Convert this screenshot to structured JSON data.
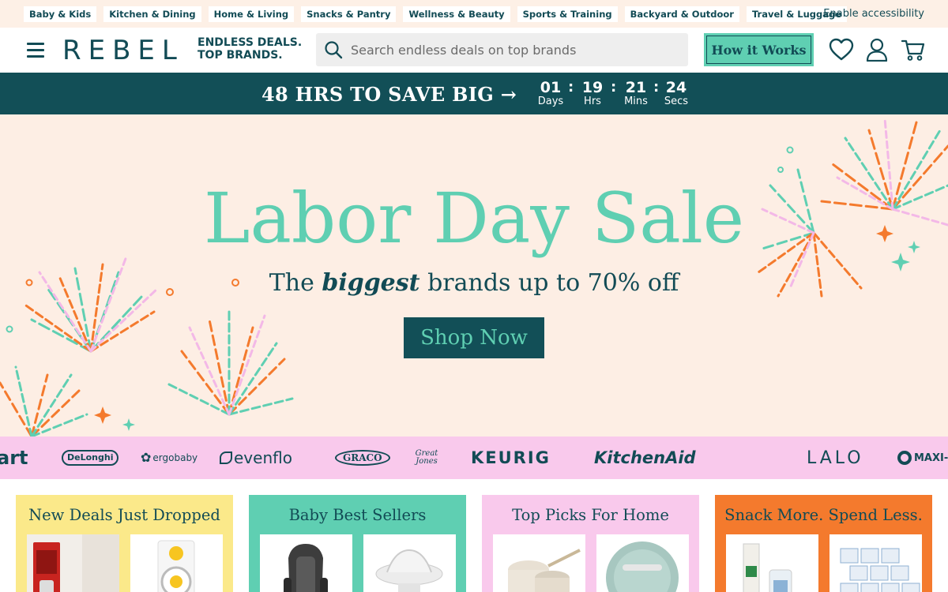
{
  "categories": [
    "Baby & Kids",
    "Kitchen & Dining",
    "Home & Living",
    "Snacks & Pantry",
    "Wellness & Beauty",
    "Sports & Training",
    "Backyard & Outdoor",
    "Travel & Luggage"
  ],
  "accessibility_label": "Enable accessibility",
  "header": {
    "logo": "REBEL",
    "tagline_line1": "ENDLESS DEALS.",
    "tagline_line2": "TOP BRANDS.",
    "search_placeholder": "Search endless deals on top brands",
    "how_it_works": "How it Works",
    "icons": [
      "menu-icon",
      "heart-icon",
      "user-icon",
      "cart-icon",
      "search-icon"
    ]
  },
  "countdown": {
    "headline": "48 HRS TO SAVE BIG →",
    "days": "01",
    "days_label": "Days",
    "hrs": "19",
    "hrs_label": "Hrs",
    "mins": "21",
    "mins_label": "Mins",
    "secs": "24",
    "secs_label": "Secs"
  },
  "hero": {
    "title": "Labor Day Sale",
    "sub_pre": "The ",
    "sub_em": "biggest",
    "sub_post": " brands up to 70% off",
    "cta": "Shop Now"
  },
  "brands": [
    "art",
    "DeLonghi",
    "ergobaby",
    "evenflo",
    "GRACO",
    "Great Jones",
    "KEURIG",
    "KitchenAid",
    "LALO",
    "MAXI-COSI"
  ],
  "cards": [
    {
      "title": "New Deals Just Dropped",
      "color": "#fbe98a"
    },
    {
      "title": "Baby Best Sellers",
      "color": "#5fcfb2"
    },
    {
      "title": "Top Picks For Home",
      "color": "#f9c9ec"
    },
    {
      "title": "Snack More. Spend Less.",
      "color": "#f47a2d"
    }
  ],
  "colors": {
    "brand_dark": "#124b55",
    "mint": "#5fcfb2",
    "peach": "#fdeee4",
    "pink": "#f9c9ec",
    "orange": "#f47a2d",
    "yellow": "#fbe98a"
  }
}
